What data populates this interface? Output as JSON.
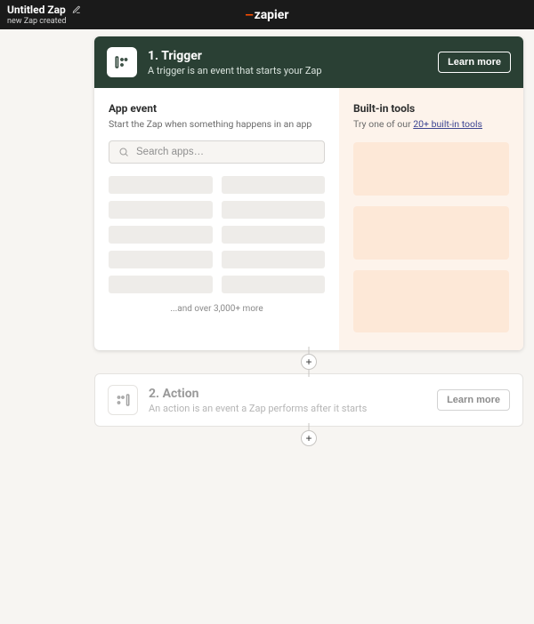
{
  "topbar": {
    "zap_title": "Untitled Zap",
    "toast": "new Zap created",
    "logo_text": "zapier"
  },
  "trigger": {
    "title": "1. Trigger",
    "subtitle": "A trigger is an event that starts your Zap",
    "learn_more": "Learn more",
    "app_event": {
      "title": "App event",
      "subtitle": "Start the Zap when something happens in an app",
      "search_placeholder": "Search apps…",
      "more_text": "...and over 3,000+ more"
    },
    "builtin": {
      "title": "Built-in tools",
      "prefix": "Try one of our ",
      "link": "20+ built-in tools"
    }
  },
  "action": {
    "title": "2. Action",
    "subtitle": "An action is an event a Zap performs after it starts",
    "learn_more": "Learn more"
  }
}
